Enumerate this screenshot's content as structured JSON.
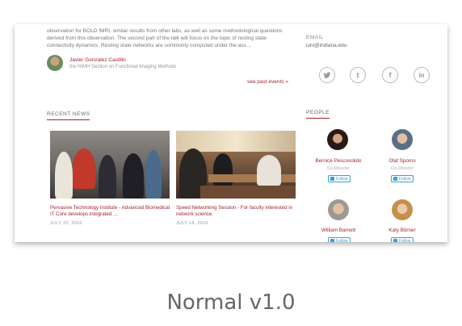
{
  "event": {
    "description": "observation for BOLD fMRI, similar results from other labs, as well as some methodological questions derived from this observation. The second part of the talk will focus on the topic of resting state connectivity dynamics. Resting state networks are commonly computed under the ass…",
    "speaker_name": "Javier Gonzalez Castillo",
    "speaker_affiliation": "the NIMH Section on Functional Imaging Methods",
    "see_past": "see past events »"
  },
  "news": {
    "heading": "RECENT NEWS",
    "items": [
      {
        "title": "Pervasive Technology Institute - Advanced Biomedical IT Core develops integrated …",
        "date": "JULY 25, 2016"
      },
      {
        "title": "Speed Networking Session - For faculty interested in network science.",
        "date": "JULY 18, 2016"
      }
    ]
  },
  "contact": {
    "email_label": "EMAIL",
    "email_value": "iuni@indiana.edu"
  },
  "social": {
    "icons": [
      {
        "name": "twitter-icon",
        "glyph": "🐦"
      },
      {
        "name": "tumblr-icon",
        "glyph": "t"
      },
      {
        "name": "facebook-icon",
        "glyph": "f"
      },
      {
        "name": "linkedin-icon",
        "glyph": "in"
      }
    ]
  },
  "people": {
    "heading": "PEOPLE",
    "follow_label": "Follow",
    "items": [
      {
        "name": "Bernice Pescosolido",
        "role": "Co-Director"
      },
      {
        "name": "Olaf Sporns",
        "role": "Co-Director"
      },
      {
        "name": "William Barnett",
        "role": ""
      },
      {
        "name": "Katy Börner",
        "role": ""
      }
    ]
  },
  "caption": "Normal v1.0",
  "colors": {
    "accent": "#a0262e",
    "twitter": "#3b9fd8"
  }
}
